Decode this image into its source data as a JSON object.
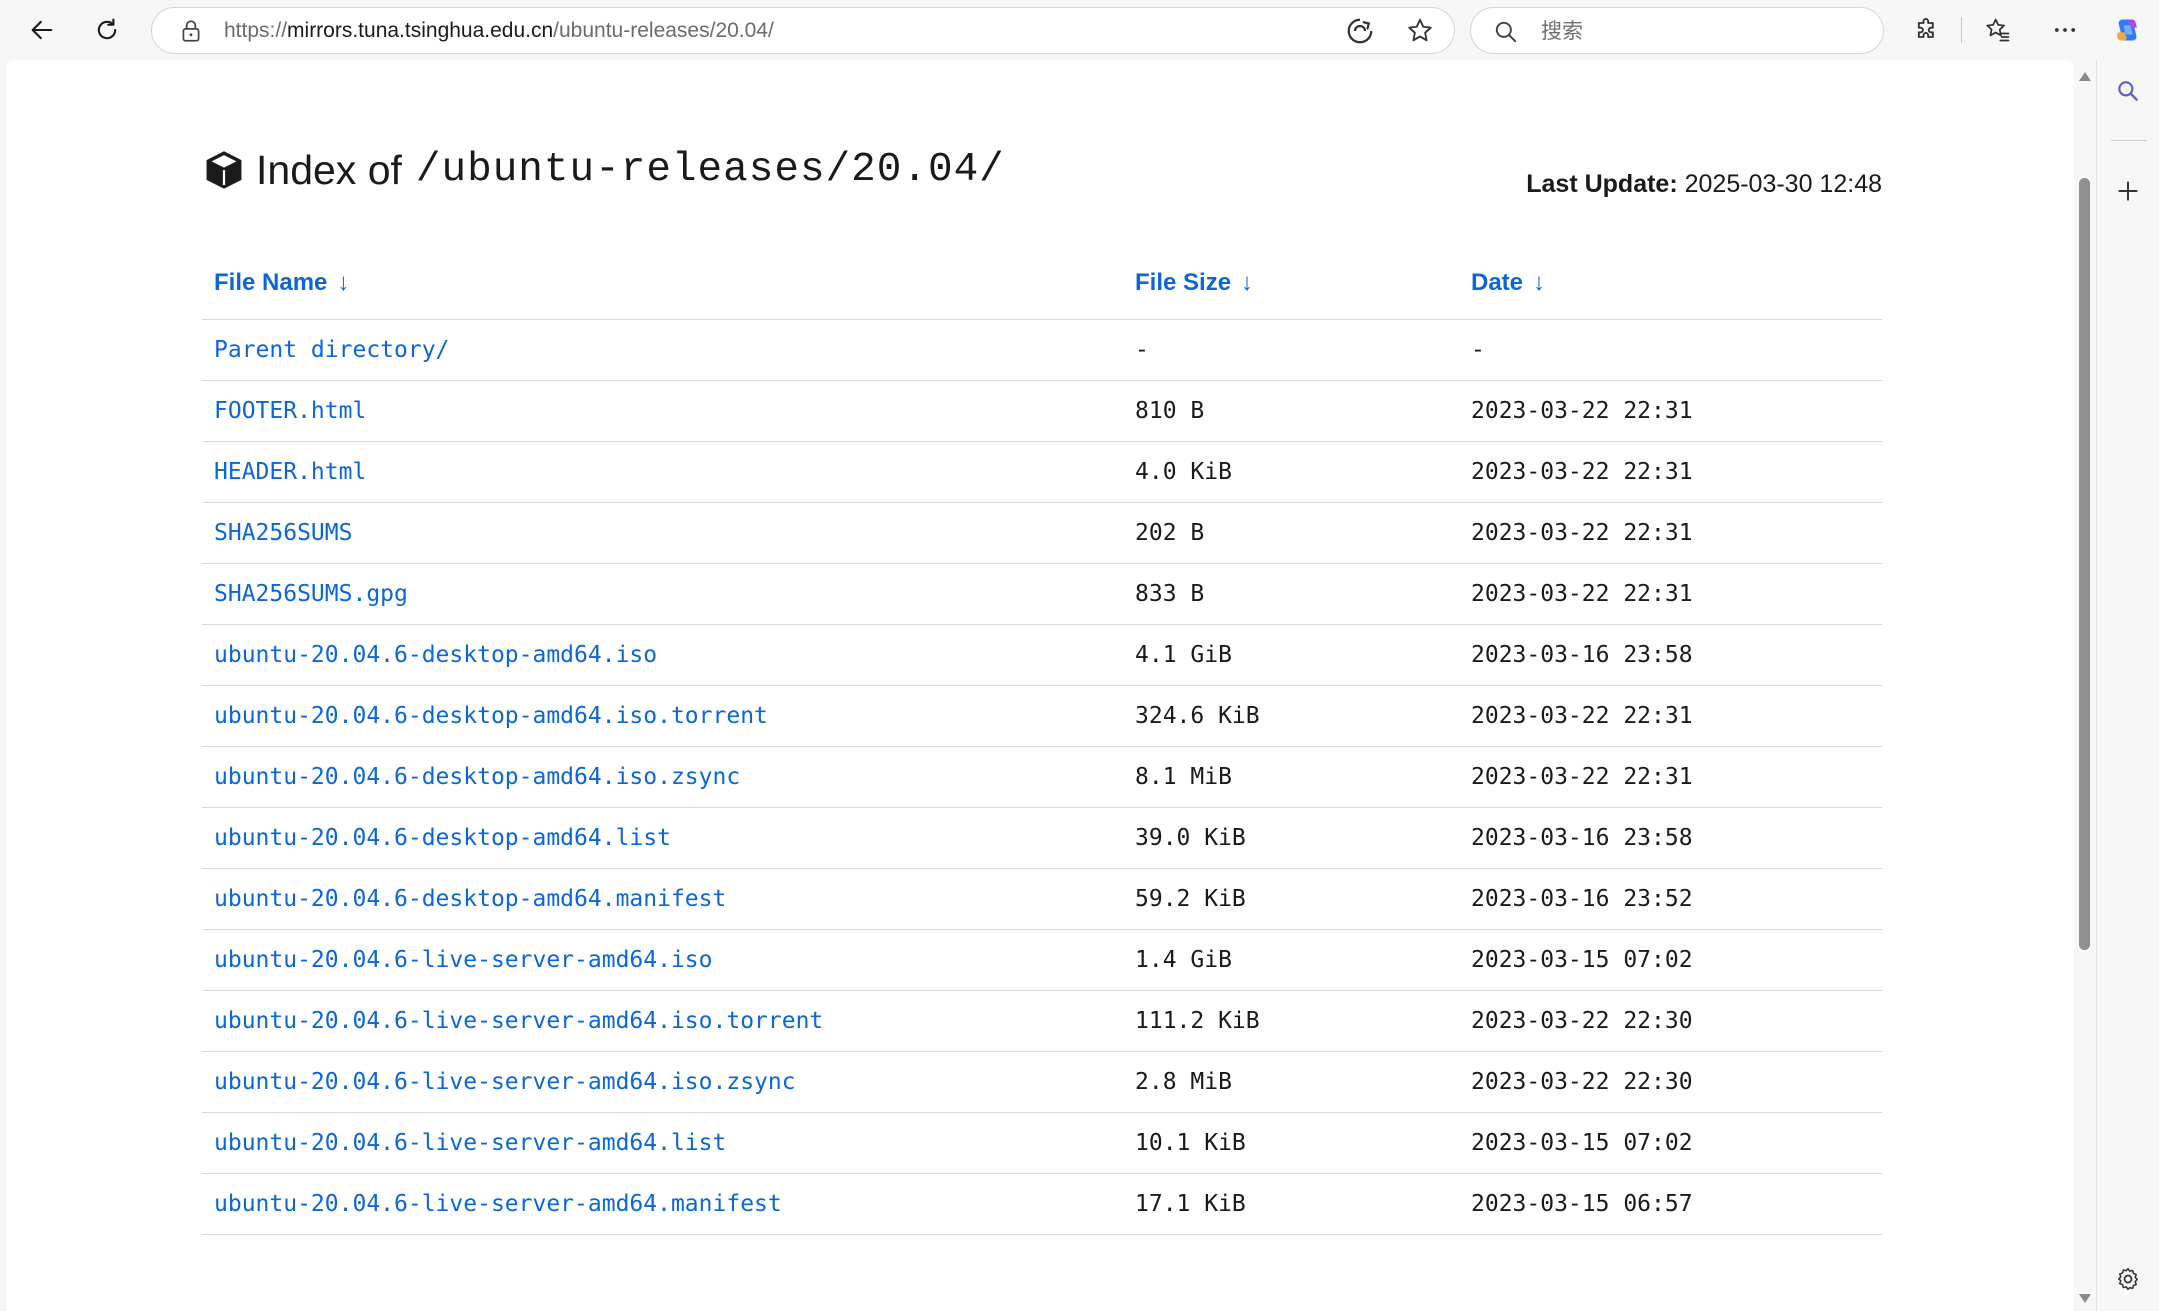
{
  "browser": {
    "url_prefix": "https://",
    "url_host": "mirrors.tuna.tsinghua.edu.cn",
    "url_path": "/ubuntu-releases/20.04/",
    "search_placeholder": "搜索"
  },
  "page": {
    "heading_label": "Index of",
    "heading_path": "/ubuntu-releases/20.04/",
    "last_update_label": "Last Update:",
    "last_update_value": "2025-03-30 12:48",
    "columns": [
      {
        "label": "File Name",
        "arrow": "↓"
      },
      {
        "label": "File Size",
        "arrow": "↓"
      },
      {
        "label": "Date",
        "arrow": "↓"
      }
    ],
    "rows": [
      {
        "name": "Parent directory/",
        "size": "-",
        "date": "-"
      },
      {
        "name": "FOOTER.html",
        "size": "810 B",
        "date": "2023-03-22 22:31"
      },
      {
        "name": "HEADER.html",
        "size": "4.0 KiB",
        "date": "2023-03-22 22:31"
      },
      {
        "name": "SHA256SUMS",
        "size": "202 B",
        "date": "2023-03-22 22:31"
      },
      {
        "name": "SHA256SUMS.gpg",
        "size": "833 B",
        "date": "2023-03-22 22:31"
      },
      {
        "name": "ubuntu-20.04.6-desktop-amd64.iso",
        "size": "4.1 GiB",
        "date": "2023-03-16 23:58"
      },
      {
        "name": "ubuntu-20.04.6-desktop-amd64.iso.torrent",
        "size": "324.6 KiB",
        "date": "2023-03-22 22:31"
      },
      {
        "name": "ubuntu-20.04.6-desktop-amd64.iso.zsync",
        "size": "8.1 MiB",
        "date": "2023-03-22 22:31"
      },
      {
        "name": "ubuntu-20.04.6-desktop-amd64.list",
        "size": "39.0 KiB",
        "date": "2023-03-16 23:58"
      },
      {
        "name": "ubuntu-20.04.6-desktop-amd64.manifest",
        "size": "59.2 KiB",
        "date": "2023-03-16 23:52"
      },
      {
        "name": "ubuntu-20.04.6-live-server-amd64.iso",
        "size": "1.4 GiB",
        "date": "2023-03-15 07:02"
      },
      {
        "name": "ubuntu-20.04.6-live-server-amd64.iso.torrent",
        "size": "111.2 KiB",
        "date": "2023-03-22 22:30"
      },
      {
        "name": "ubuntu-20.04.6-live-server-amd64.iso.zsync",
        "size": "2.8 MiB",
        "date": "2023-03-22 22:30"
      },
      {
        "name": "ubuntu-20.04.6-live-server-amd64.list",
        "size": "10.1 KiB",
        "date": "2023-03-15 07:02"
      },
      {
        "name": "ubuntu-20.04.6-live-server-amd64.manifest",
        "size": "17.1 KiB",
        "date": "2023-03-15 06:57"
      }
    ]
  },
  "icons": {
    "toolbar": [
      "back-icon",
      "refresh-icon",
      "lock-icon",
      "immersive-reader-icon",
      "favorite-star-icon",
      "search-icon",
      "extensions-icon",
      "favorites-icon",
      "more-icon",
      "copilot-icon"
    ],
    "sidepanel": [
      "sidebar-search-icon",
      "sidebar-add-icon",
      "sidebar-settings-icon"
    ],
    "heading": "package-box-icon"
  },
  "colors": {
    "link": "#0b66d8",
    "chrome_bg": "#f7f7f7",
    "page_bg": "#ffffff",
    "row_border": "#d8d8d8"
  }
}
